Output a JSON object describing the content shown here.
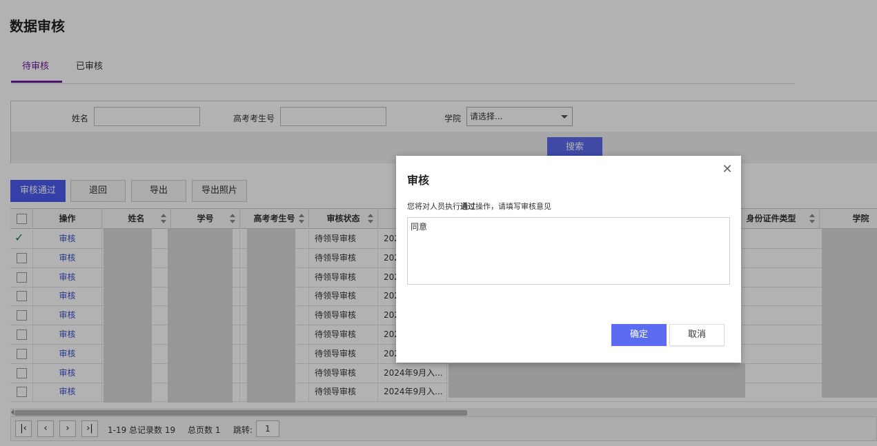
{
  "page": {
    "title": "数据审核"
  },
  "tabs": [
    {
      "label": "待审核",
      "active": true
    },
    {
      "label": "已审核",
      "active": false
    }
  ],
  "search": {
    "name_label": "姓名",
    "name_value": "",
    "exam_no_label": "高考考生号",
    "exam_no_value": "",
    "college_label": "学院",
    "college_selected": "请选择...",
    "search_button": "搜索"
  },
  "toolbar": {
    "approve": "审核通过",
    "return": "退回",
    "export": "导出",
    "export_photos": "导出照片"
  },
  "table": {
    "columns": [
      "操作",
      "姓名",
      "学号",
      "高考考生号",
      "审核状态",
      "身份证件类型",
      "学院"
    ],
    "rows": [
      {
        "action": "审核",
        "status": "待领导审核",
        "date": "202",
        "checked": true
      },
      {
        "action": "审核",
        "status": "待领导审核",
        "date": "202",
        "checked": false
      },
      {
        "action": "审核",
        "status": "待领导审核",
        "date": "202",
        "checked": false
      },
      {
        "action": "审核",
        "status": "待领导审核",
        "date": "202",
        "checked": false
      },
      {
        "action": "审核",
        "status": "待领导审核",
        "date": "202",
        "checked": false
      },
      {
        "action": "审核",
        "status": "待领导审核",
        "date": "202",
        "checked": false
      },
      {
        "action": "审核",
        "status": "待领导审核",
        "date": "202",
        "checked": false
      },
      {
        "action": "审核",
        "status": "待领导审核",
        "date": "2024年9月入...",
        "checked": false
      },
      {
        "action": "审核",
        "status": "待领导审核",
        "date": "2024年9月入...",
        "checked": false
      }
    ]
  },
  "pager": {
    "summary": "1-19 总记录数 19",
    "total_pages": "总页数 1",
    "jump_label": "跳转:",
    "jump_value": "1"
  },
  "dialog": {
    "title": "审核",
    "message_prefix": "您将对人员执行",
    "message_action": "通过",
    "message_suffix": "操作，请填写审核意见",
    "comment": "同意",
    "ok": "确定",
    "cancel": "取消"
  },
  "colors": {
    "primary": "#5b6cf0",
    "tab_active": "#6a1b9a",
    "link": "#3a4ec8"
  }
}
